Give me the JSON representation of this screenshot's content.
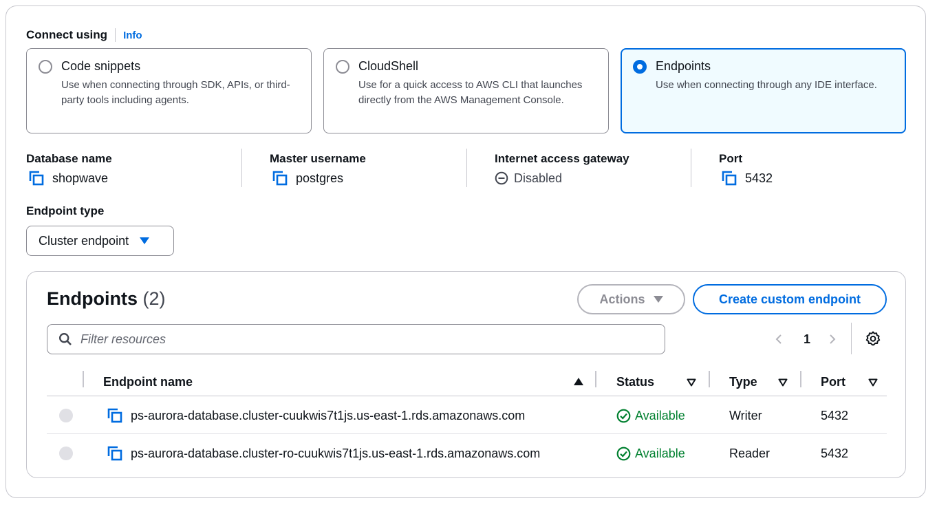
{
  "connect": {
    "label": "Connect using",
    "info": "Info",
    "options": [
      {
        "title": "Code snippets",
        "description": "Use when connecting through SDK, APIs, or third-party tools including agents.",
        "selected": false
      },
      {
        "title": "CloudShell",
        "description": "Use for a quick access to AWS CLI that launches directly from the AWS Management Console.",
        "selected": false
      },
      {
        "title": "Endpoints",
        "description": "Use when connecting through any IDE interface.",
        "selected": true
      }
    ]
  },
  "details": {
    "database_name": {
      "label": "Database name",
      "value": "shopwave"
    },
    "master_username": {
      "label": "Master username",
      "value": "postgres"
    },
    "internet_gateway": {
      "label": "Internet access gateway",
      "value": "Disabled"
    },
    "port": {
      "label": "Port",
      "value": "5432"
    }
  },
  "endpoint_type": {
    "label": "Endpoint type",
    "selected": "Cluster endpoint"
  },
  "endpoints": {
    "title": "Endpoints",
    "count": "(2)",
    "actions_label": "Actions",
    "create_label": "Create custom endpoint",
    "filter_placeholder": "Filter resources",
    "page": "1",
    "columns": [
      "Endpoint name",
      "Status",
      "Type",
      "Port"
    ],
    "rows": [
      {
        "name": "ps-aurora-database.cluster-cuukwis7t1js.us-east-1.rds.amazonaws.com",
        "status": "Available",
        "type": "Writer",
        "port": "5432"
      },
      {
        "name": "ps-aurora-database.cluster-ro-cuukwis7t1js.us-east-1.rds.amazonaws.com",
        "status": "Available",
        "type": "Reader",
        "port": "5432"
      }
    ]
  },
  "colors": {
    "accent": "#006ce0",
    "available": "#00802f",
    "selected_tile_bg": "#f0fbff",
    "border": "#8c8c94"
  }
}
